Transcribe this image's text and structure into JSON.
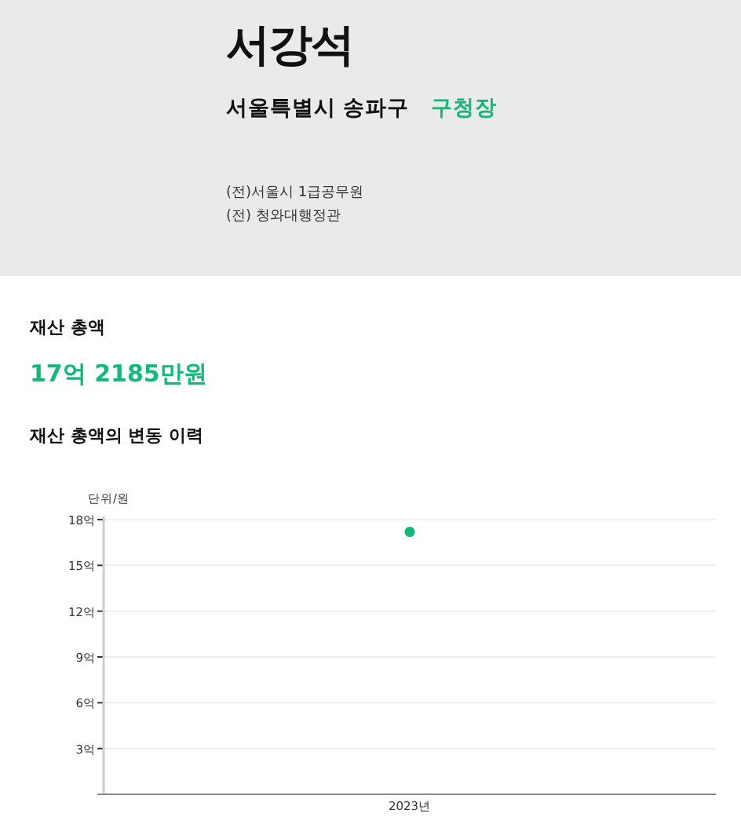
{
  "profile": {
    "name": "서강석",
    "region": "서울특별시 송파구",
    "position": "구청장",
    "careers": [
      "(전)서울시 1급공무원",
      "(전) 청와대행정관"
    ]
  },
  "assets": {
    "total_label": "재산 총액",
    "total_value": "17억 2185만원",
    "history_title": "재산 총액의 변동 이력",
    "chart_data": {
      "type": "scatter",
      "ylabel": "단위/원",
      "categories": [
        "2023년"
      ],
      "series": [
        {
          "color": "#13b87a",
          "values": [
            17.2
          ]
        }
      ],
      "ylim": [
        0,
        18
      ],
      "grid": true,
      "yticks": [
        {
          "value": 3,
          "label": "3억"
        },
        {
          "value": 6,
          "label": "6억"
        },
        {
          "value": 9,
          "label": "9억"
        },
        {
          "value": 12,
          "label": "12억"
        },
        {
          "value": 15,
          "label": "15억"
        },
        {
          "value": 18,
          "label": "18억"
        }
      ]
    }
  }
}
